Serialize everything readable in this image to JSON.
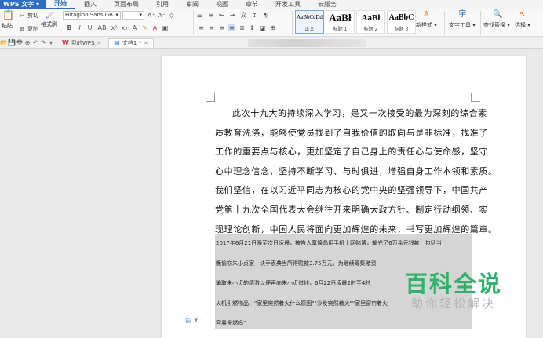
{
  "app": {
    "name": "WPS 文字"
  },
  "menu": [
    "开始",
    "插入",
    "页面布局",
    "引用",
    "审阅",
    "视图",
    "章节",
    "开发工具",
    "云服务"
  ],
  "ribbon": {
    "paste_label": "粘贴",
    "cut_label": "剪切",
    "copy_label": "复制",
    "format_painter_label": "格式刷",
    "font_name": "Hiragino Sans GB",
    "font_size": "",
    "styles": [
      {
        "sample": "AaBbCcDd",
        "name": "正文"
      },
      {
        "sample": "AaBł",
        "name": "标题 1"
      },
      {
        "sample": "AaBł",
        "name": "标题 2"
      },
      {
        "sample": "AaBbC",
        "name": "标题 3"
      }
    ],
    "new_style_label": "新样式",
    "text_tools_label": "文字工具",
    "find_replace_label": "查找替换",
    "select_label": "选择"
  },
  "tabs": [
    {
      "label": "我的WPS"
    },
    {
      "label": "文档1 *"
    }
  ],
  "document": {
    "lines": [
      "此次十九大的持续深入学习，是又一次接受的最为深刻的综合素",
      "质教育洗涤，能够使党员找到了自我价值的取向与是非标准，找准了",
      "工作的重要点与核心，更加坚定了自己身上的责任心与使命感，坚守",
      "心中理念信念，坚持不断学习、与时俱进，增强自身工作本领和素质。",
      "我们坚信，在以习近平同志为核心的党中央的坚强领导下，中国共产",
      "党第十九次全国代表大会继往开来明确大政方针、制定行动纲领、实",
      "现理论创新，中国人民将面向更加辉煌的未来，书写更加辉煌的篇章。"
    ],
    "highlighted_lines": [
      "2017年6月21日晚至次日凌晨，被告人莫焕晶用手机上网赌博，输光了6万余元钱款，包括当",
      "晚偷窃朱小贞家一块手表典当所得赃款3.75万元。为继续筹集赌资",
      "骗取朱小贞的感激以便再向朱小贞借钱，6月22日凌晨2时至4时",
      "火机引燃物品，\"家里突然着火什么原因\"\"沙发突然着火\"\"家里窗帘着火",
      "容易慢燃吗\""
    ]
  },
  "watermark": {
    "main": "百科全说",
    "sub": "助你轻松解决",
    "color": "#2fb36b"
  },
  "colors": {
    "accent": "#2b6cc4"
  }
}
